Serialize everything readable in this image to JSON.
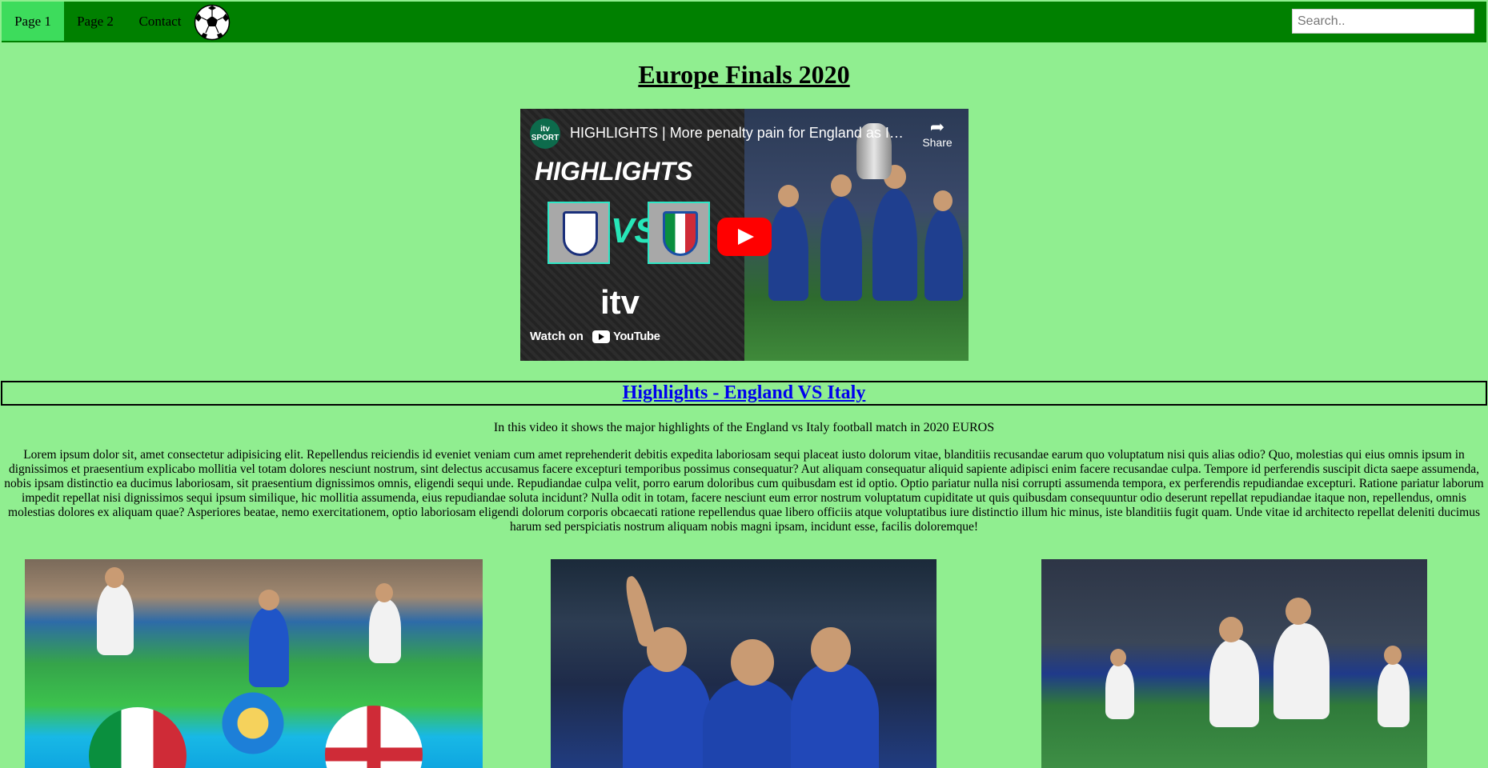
{
  "nav": {
    "items": [
      {
        "label": "Page 1",
        "active": true
      },
      {
        "label": "Page 2",
        "active": false
      },
      {
        "label": "Contact",
        "active": false
      }
    ],
    "logo_icon": "soccer-ball-icon",
    "search_placeholder": "Search.."
  },
  "main": {
    "title": "Europe Finals 2020",
    "video": {
      "channel": "itv SPORT",
      "title": "HIGHLIGHTS | More penalty pain for England as Ita...",
      "share_label": "Share",
      "thumb_text": "HIGHLIGHTS",
      "vs_text": "VS",
      "logo_text": "itv",
      "watch_on": "Watch on",
      "youtube": "YouTube"
    },
    "subheading_link": "Highlights - England VS Italy",
    "intro": "In this video it shows the major highlights of the England vs Italy football match in 2020 EUROS",
    "lorem": "Lorem ipsum dolor sit, amet consectetur adipisicing elit. Repellendus reiciendis id eveniet veniam cum amet reprehenderit debitis expedita laboriosam sequi placeat iusto dolorum vitae, blanditiis recusandae earum quo voluptatum nisi quis alias odio? Quo, molestias qui eius omnis ipsum in dignissimos et praesentium explicabo mollitia vel totam dolores nesciunt nostrum, sint delectus accusamus facere excepturi temporibus possimus consequatur? Aut aliquam consequatur aliquid sapiente adipisci enim facere recusandae culpa. Tempore id perferendis suscipit dicta saepe assumenda, nobis ipsam distinctio ea ducimus laboriosam, sit praesentium dignissimos omnis, eligendi sequi unde. Repudiandae culpa velit, porro earum doloribus cum quibusdam est id optio. Optio pariatur nulla nisi corrupti assumenda tempora, ex perferendis repudiandae excepturi. Ratione pariatur laborum impedit repellat nisi dignissimos sequi ipsum similique, hic mollitia assumenda, eius repudiandae soluta incidunt? Nulla odit in totam, facere nesciunt eum error nostrum voluptatum cupiditate ut quis quibusdam consequuntur odio deserunt repellat repudiandae itaque non, repellendus, omnis molestias dolores ex aliquam quae? Asperiores beatae, nemo exercitationem, optio laboriosam eligendi dolorum corporis obcaecati ratione repellendus quae libero officiis atque voluptatibus iure distinctio illum hic minus, iste blanditiis fugit quam. Unde vitae id architecto repellat deleniti ducimus harum sed perspiciatis nostrum aliquam nobis magni ipsam, incidunt esse, facilis doloremque!"
  },
  "colors": {
    "page_bg": "#90ee90",
    "nav_bg": "#008000",
    "nav_active": "#3ddc5c",
    "link": "#0000ee"
  }
}
